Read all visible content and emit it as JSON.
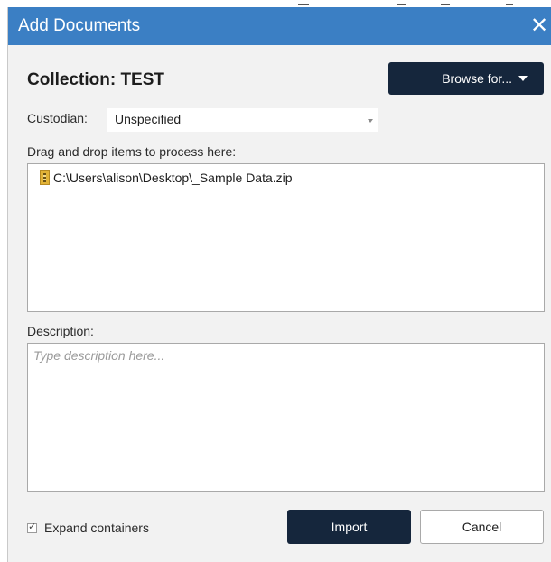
{
  "dialog": {
    "title": "Add Documents",
    "close_icon": "close-icon"
  },
  "collection": {
    "heading": "Collection: TEST"
  },
  "toolbar": {
    "browse_label": "Browse for...",
    "browse_icon": "chevron-down-icon"
  },
  "custodian": {
    "label": "Custodian:",
    "selected": "Unspecified"
  },
  "drop_area": {
    "label": "Drag and drop items to process here:",
    "items": [
      {
        "icon": "zip-file-icon",
        "path": "C:\\Users\\alison\\Desktop\\_Sample Data.zip"
      }
    ]
  },
  "description": {
    "label": "Description:",
    "value": "",
    "placeholder": "Type description here..."
  },
  "options": {
    "expand_containers_label": "Expand containers",
    "expand_containers_checked": true
  },
  "actions": {
    "import_label": "Import",
    "cancel_label": "Cancel"
  },
  "colors": {
    "titlebar": "#3b7fc4",
    "primary_button": "#15263c",
    "dialog_background": "#f2f2f2"
  }
}
